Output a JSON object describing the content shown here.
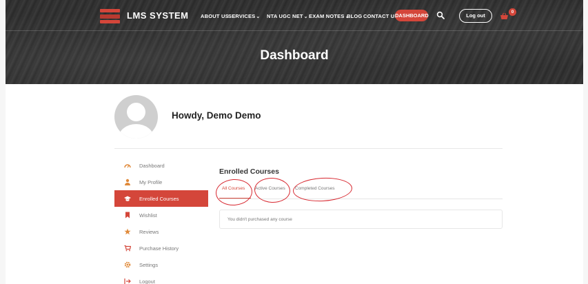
{
  "header": {
    "logo_text": "LMS SYSTEM",
    "nav": [
      {
        "label": "ABOUT US",
        "has_dropdown": false
      },
      {
        "label": "SERVICES",
        "has_dropdown": true
      },
      {
        "label": "NTA UGC NET",
        "has_dropdown": true
      },
      {
        "label": "EXAM NOTES",
        "has_dropdown": true
      },
      {
        "label": "BLOG",
        "has_dropdown": false
      },
      {
        "label": "CONTACT US",
        "has_dropdown": false
      }
    ],
    "active_nav": "DASHBOARD",
    "logout_label": "Log out",
    "cart_count": "0",
    "icons": {
      "search": "search-icon",
      "cart": "cart-icon",
      "dropdown": "chevron-down-icon"
    }
  },
  "hero": {
    "title": "Dashboard"
  },
  "profile": {
    "greeting": "Howdy, Demo Demo"
  },
  "sidebar": {
    "items": [
      {
        "label": "Dashboard",
        "icon": "dashboard-icon",
        "active": false
      },
      {
        "label": "My Profile",
        "icon": "user-icon",
        "active": false
      },
      {
        "label": "Enrolled Courses",
        "icon": "graduation-cap-icon",
        "active": true
      },
      {
        "label": "Wishlist",
        "icon": "bookmark-icon",
        "active": false
      },
      {
        "label": "Reviews",
        "icon": "star-icon",
        "active": false
      },
      {
        "label": "Purchase History",
        "icon": "cart-icon",
        "active": false
      },
      {
        "label": "Settings",
        "icon": "gear-icon",
        "active": false
      },
      {
        "label": "Logout",
        "icon": "logout-icon",
        "active": false
      }
    ]
  },
  "main": {
    "section_title": "Enrolled Courses",
    "tabs": [
      {
        "label": "All Courses",
        "active": true
      },
      {
        "label": "Active Courses",
        "active": false
      },
      {
        "label": "Completed Courses",
        "active": false
      }
    ],
    "empty_message": "You didn't purchased any course"
  },
  "colors": {
    "accent": "#d4463a",
    "annotation": "#d7262e",
    "hero_bg": "#2f2f2f"
  }
}
